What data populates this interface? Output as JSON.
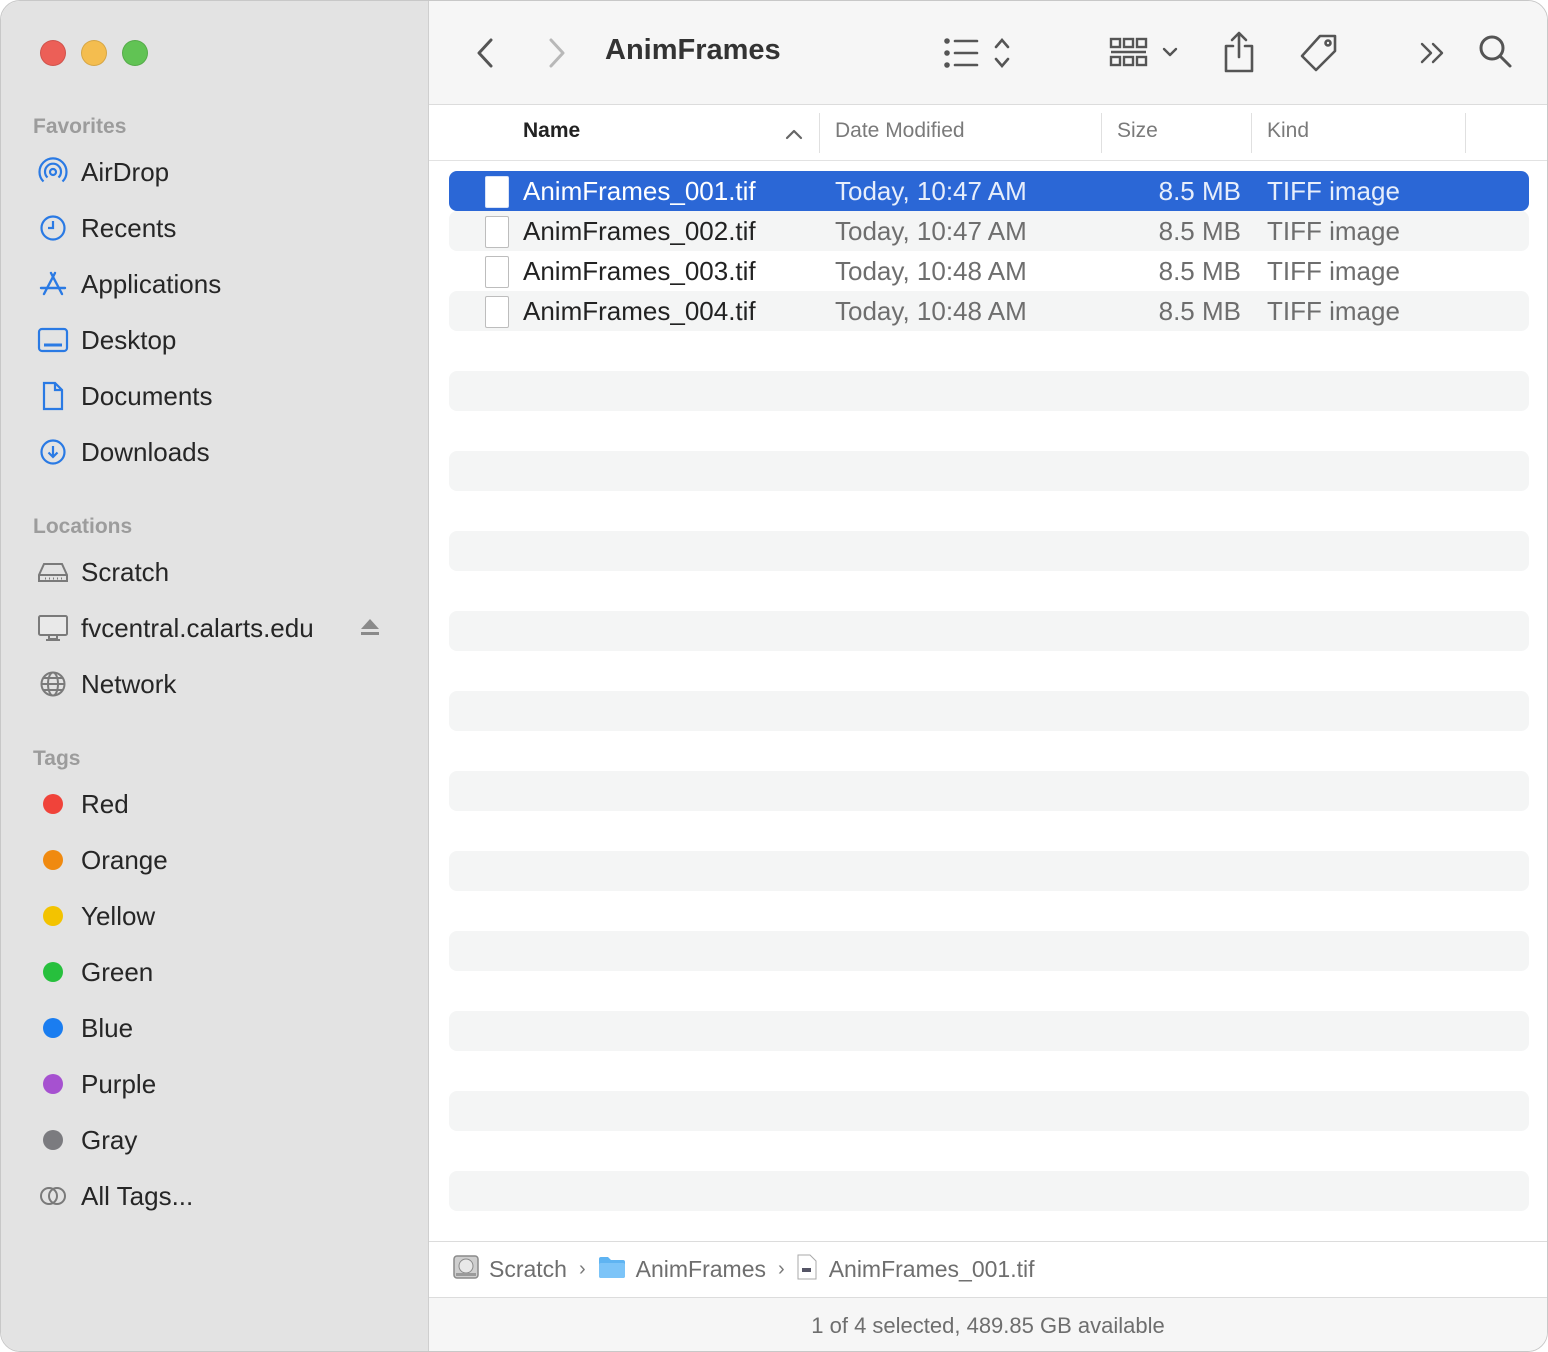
{
  "window": {
    "title": "AnimFrames",
    "traffic_lights": {
      "close": "#ec5f57",
      "minimize": "#f4bd4f",
      "zoom": "#61c354"
    }
  },
  "sidebar": {
    "favorites_title": "Favorites",
    "favorites": [
      {
        "label": "AirDrop",
        "icon": "airdrop-icon"
      },
      {
        "label": "Recents",
        "icon": "clock-icon"
      },
      {
        "label": "Applications",
        "icon": "applications-icon"
      },
      {
        "label": "Desktop",
        "icon": "desktop-icon"
      },
      {
        "label": "Documents",
        "icon": "document-icon"
      },
      {
        "label": "Downloads",
        "icon": "download-icon"
      }
    ],
    "locations_title": "Locations",
    "locations": [
      {
        "label": "Scratch",
        "icon": "drive-icon"
      },
      {
        "label": "fvcentral.calarts.edu",
        "icon": "display-icon"
      },
      {
        "label": "Network",
        "icon": "globe-icon"
      }
    ],
    "tags_title": "Tags",
    "tags": [
      {
        "label": "Red",
        "color": "#f0433a"
      },
      {
        "label": "Orange",
        "color": "#f08a10"
      },
      {
        "label": "Yellow",
        "color": "#f3c300"
      },
      {
        "label": "Green",
        "color": "#27c03d"
      },
      {
        "label": "Blue",
        "color": "#1a7df0"
      },
      {
        "label": "Purple",
        "color": "#a651d0"
      },
      {
        "label": "Gray",
        "color": "#7b7b7f"
      },
      {
        "label": "All Tags...",
        "color": ""
      }
    ]
  },
  "columns": {
    "name": "Name",
    "date": "Date Modified",
    "size": "Size",
    "kind": "Kind"
  },
  "files": [
    {
      "name": "AnimFrames_001.tif",
      "date": "Today, 10:47 AM",
      "size": "8.5 MB",
      "kind": "TIFF image",
      "selected": true
    },
    {
      "name": "AnimFrames_002.tif",
      "date": "Today, 10:47 AM",
      "size": "8.5 MB",
      "kind": "TIFF image",
      "selected": false
    },
    {
      "name": "AnimFrames_003.tif",
      "date": "Today, 10:48 AM",
      "size": "8.5 MB",
      "kind": "TIFF image",
      "selected": false
    },
    {
      "name": "AnimFrames_004.tif",
      "date": "Today, 10:48 AM",
      "size": "8.5 MB",
      "kind": "TIFF image",
      "selected": false
    }
  ],
  "path": {
    "drive": "Scratch",
    "folder": "AnimFrames",
    "file": "AnimFrames_001.tif"
  },
  "status": "1 of 4 selected, 489.85 GB available",
  "accent": "#2b67d6"
}
